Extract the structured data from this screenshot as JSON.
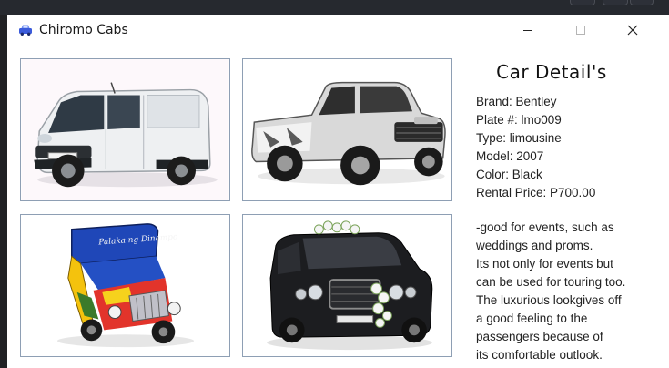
{
  "window": {
    "title": "Chiromo Cabs",
    "controls": [
      "minimize-icon",
      "maximize-icon",
      "close-icon"
    ]
  },
  "gallery": [
    {
      "name": "white-van",
      "icon": "van"
    },
    {
      "name": "pickup-truck",
      "icon": "pickup-truck"
    },
    {
      "name": "jeepney",
      "icon": "jeepney"
    },
    {
      "name": "wedding-limousine",
      "icon": "limousine"
    }
  ],
  "details": {
    "title": "Car Detail's",
    "lines": [
      "Brand: Bentley",
      "Plate #: lmo009",
      "Type: limousine",
      "Model: 2007",
      "Color: Black",
      "Rental Price: P700.00"
    ],
    "description": [
      "-good for events, such as",
      "weddings and proms.",
      "Its not only for events but",
      "can be used for touring too.",
      "The luxurious lookgives off",
      "a good feeling to the",
      "passengers because of",
      "its comfortable outlook."
    ]
  },
  "colors": {
    "titlebar": "#ffffff",
    "photo_border": "#8e9fb4",
    "app_icon": "#3b5bdb"
  }
}
